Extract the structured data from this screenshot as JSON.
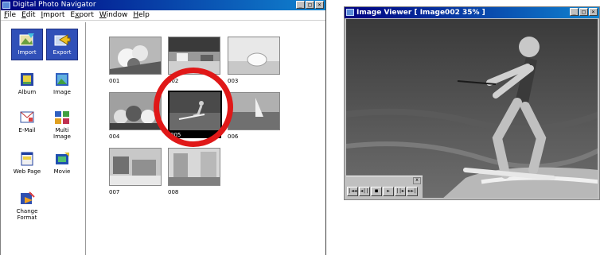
{
  "navigator": {
    "title": "Digital Photo Navigator",
    "menu": [
      {
        "label": "File",
        "u": "F",
        "rest": "ile"
      },
      {
        "label": "Edit",
        "u": "E",
        "rest": "dit"
      },
      {
        "label": "Import",
        "u": "I",
        "rest": "mport"
      },
      {
        "label": "Export",
        "pre": "E",
        "u": "x",
        "rest": "port"
      },
      {
        "label": "Window",
        "u": "W",
        "rest": "indow"
      },
      {
        "label": "Help",
        "u": "H",
        "rest": "elp"
      }
    ],
    "tools": [
      {
        "label": "Import",
        "icon": "import-icon"
      },
      {
        "label": "Export",
        "icon": "export-icon"
      },
      {
        "label": "Album",
        "icon": "album-icon"
      },
      {
        "label": "Image",
        "icon": "image-icon"
      },
      {
        "label": "E-Mail",
        "icon": "email-icon"
      },
      {
        "label": "Multi Image",
        "icon": "multi-image-icon"
      },
      {
        "label": "Web Page",
        "icon": "web-page-icon"
      },
      {
        "label": "Movie",
        "icon": "movie-icon"
      },
      {
        "label": "Change Format",
        "icon": "change-format-icon"
      }
    ],
    "thumbnails": [
      {
        "label": "001",
        "subject": "flowers"
      },
      {
        "label": "002",
        "subject": "beach"
      },
      {
        "label": "003",
        "subject": "shell"
      },
      {
        "label": "004",
        "subject": "fruit"
      },
      {
        "label": "005",
        "subject": "water-skier",
        "selected": true
      },
      {
        "label": "006",
        "subject": "windsurf"
      },
      {
        "label": "007",
        "subject": "town"
      },
      {
        "label": "008",
        "subject": "street"
      }
    ],
    "colors": {
      "titlebar": "#000080",
      "selection": "#3050b8",
      "highlight": "#e01818"
    }
  },
  "viewer": {
    "title": "Image Viewer [ Image002 35% ]",
    "playbar_close": "x",
    "controls": [
      "|◄◄",
      "◄||",
      "■",
      "►",
      "||►",
      "►►|"
    ]
  }
}
